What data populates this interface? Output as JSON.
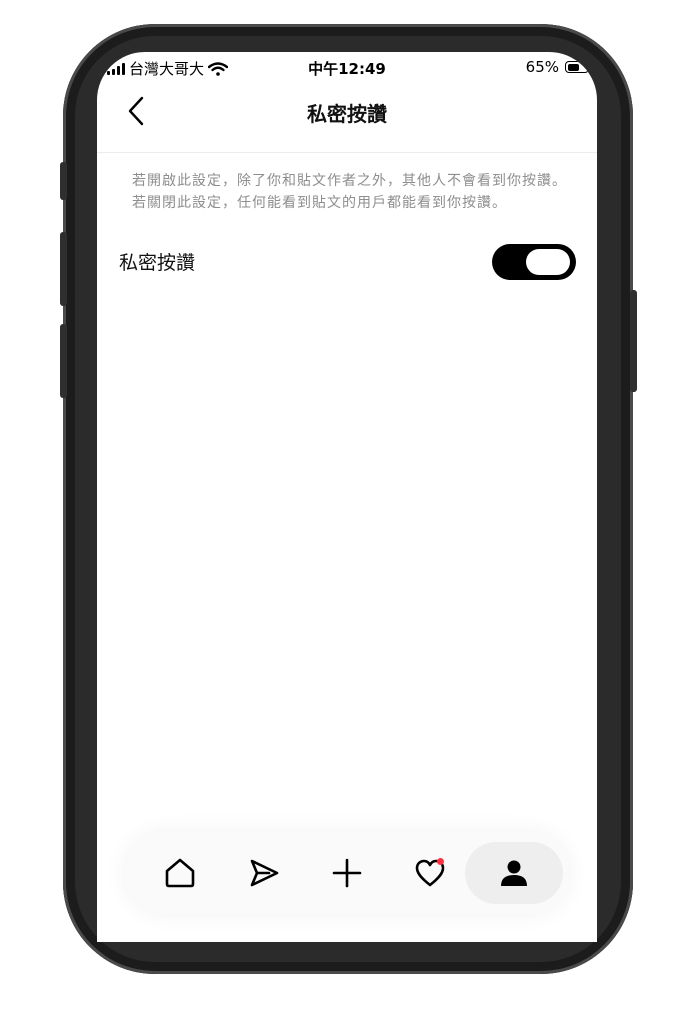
{
  "status_bar": {
    "carrier": "台灣大哥大",
    "time": "中午12:49",
    "battery": "65%",
    "battery_level": 0.65
  },
  "header": {
    "title": "私密按讚"
  },
  "content": {
    "description": "若開啟此設定，除了你和貼文作者之外，其他人不會看到你按讚。若關閉此設定，任何能看到貼文的用戶都能看到你按讚。",
    "setting_label": "私密按讚",
    "setting_enabled": true
  },
  "tab_bar": {
    "items": [
      "home-icon",
      "send-icon",
      "plus-icon",
      "heart-icon",
      "profile-icon"
    ],
    "active": "profile-icon"
  }
}
